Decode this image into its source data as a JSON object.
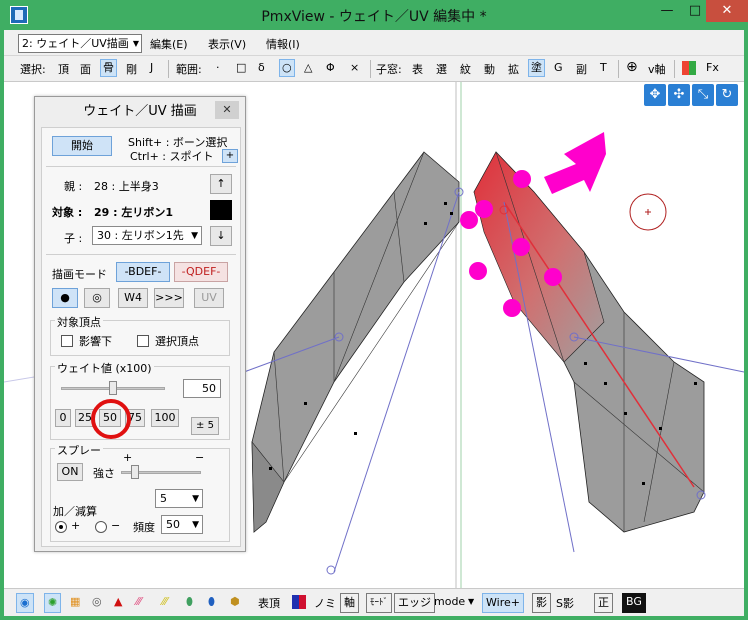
{
  "window": {
    "title": "PmxView  - ウェイト／UV 編集中 *",
    "minimize": "—",
    "maximize": "□",
    "close": "✕"
  },
  "menubar": {
    "mode_select": "2: ウェイト／UV描画",
    "items": [
      "編集(E)",
      "表示(V)",
      "情報(I)"
    ]
  },
  "toolbar": {
    "select_label": "選択:",
    "select_items": [
      "頂",
      "面",
      "骨",
      "剛",
      "J"
    ],
    "select_active": "骨",
    "range_label": "範囲:",
    "range_items": [
      "·",
      "□",
      "δ",
      "○",
      "△",
      "Φ",
      "×"
    ],
    "range_active": "○",
    "subwin_label": "子窓:",
    "subwin_items": [
      "表",
      "選",
      "紋",
      "動",
      "拡",
      "塗",
      "G",
      "副",
      "T"
    ],
    "subwin_active": "塗",
    "right_items": [
      "v軸",
      "Fx"
    ]
  },
  "panel": {
    "title": "ウェイト／UV 描画",
    "close": "✕",
    "start_button": "開始",
    "shift_hint": "Shift+ : ボーン選択",
    "ctrl_hint": "Ctrl+ : スポイト",
    "plus_button": "+",
    "parent_label": "親 :",
    "parent_value": "28 : 上半身3",
    "target_label": "対象 :",
    "target_value": "29 : 左リボン1",
    "child_label": "子 :",
    "child_value": "30 : 左リボン1先",
    "up_arrow": "↑",
    "down_arrow": "↓",
    "draw_mode_label": "描画モード",
    "bdef_button": "-BDEF-",
    "qdef_button": "-QDEF-",
    "brush_buttons": [
      "●",
      "◎",
      "W4",
      ">>>",
      "UV"
    ],
    "target_vertex_title": "対象頂点",
    "influence_under": "影響下",
    "selected_vertex": "選択頂点",
    "weight_title": "ウェイト値 (x100)",
    "weight_value": "50",
    "weight_slider_level": 0.5,
    "weight_presets": [
      "0",
      "25",
      "50",
      "75",
      "100"
    ],
    "pm5_button": "± 5",
    "spray_title": "スプレー",
    "spray_on": "ON",
    "strength_label": "強さ",
    "plus_sign": "+",
    "minus_sign": "−",
    "strength_value": "5",
    "addsub_label": "加／減算",
    "radio_plus": "+",
    "radio_minus": "−",
    "frequency_label": "頻度",
    "frequency_value": "50"
  },
  "bottombar": {
    "items_text": [
      "表頂",
      "ノミ",
      "軸",
      "ﾓｰﾄﾞ",
      "エッジ",
      "mode",
      "Wire+",
      "影",
      "S影",
      "正",
      "BG"
    ]
  },
  "colors": {
    "titlebar": "#3fae63",
    "highlight": "#ff00cc",
    "weight_red": "#e0303a",
    "mesh_gray": "#9c9c9c"
  }
}
